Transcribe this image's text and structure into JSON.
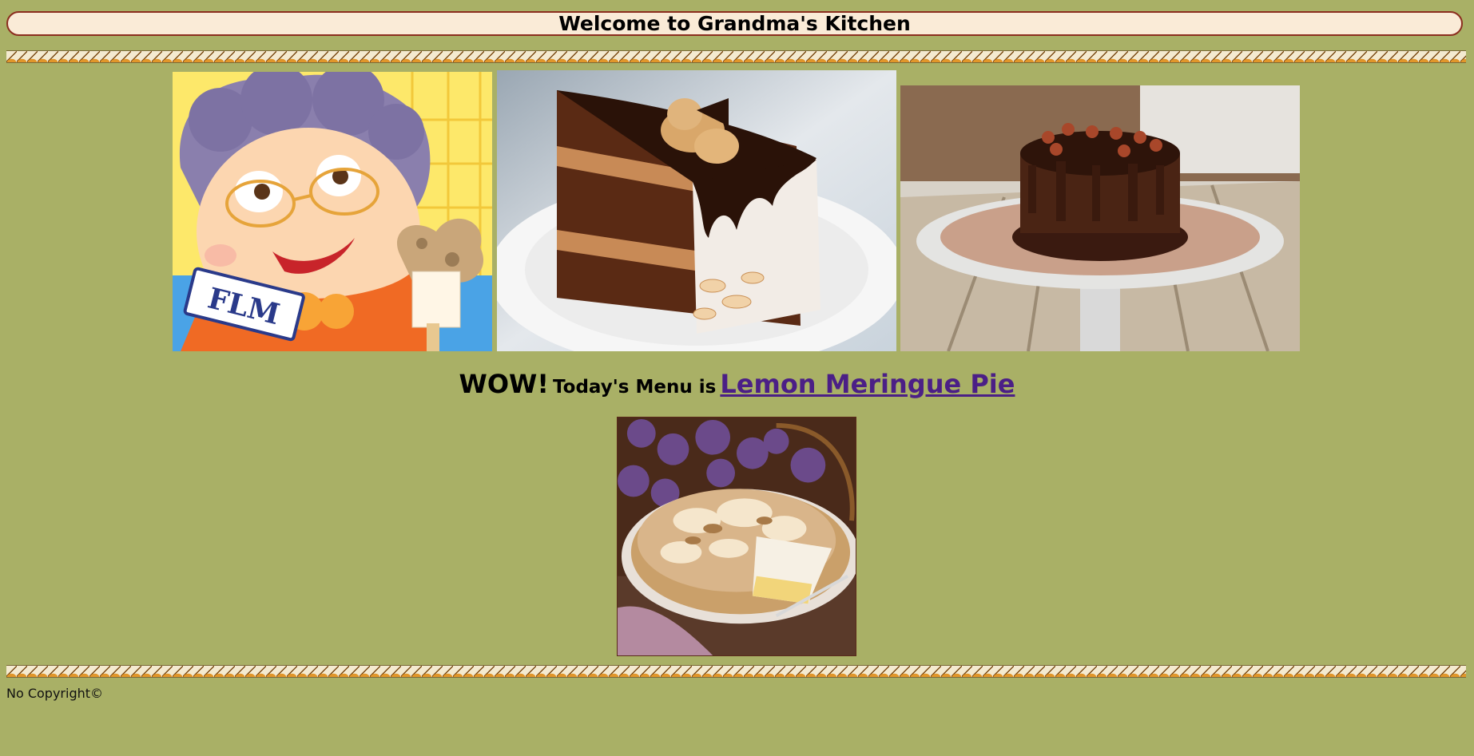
{
  "header": {
    "title": "Welcome to Grandma's Kitchen"
  },
  "gallery": {
    "images": [
      {
        "name": "grandma-illustration",
        "badge_text": "FLM"
      },
      {
        "name": "chocolate-cake-slice"
      },
      {
        "name": "chocolate-hazelnut-cake"
      }
    ]
  },
  "menu": {
    "wow": "WOW!",
    "intro": "Today's Menu is",
    "dish": "Lemon Meringue Pie"
  },
  "footer": {
    "copyright": "No Copyright©"
  },
  "colors": {
    "page_background": "#a9b066",
    "banner_background": "#faebd7",
    "banner_border": "#8b2d1e",
    "link": "#4b1f86"
  }
}
